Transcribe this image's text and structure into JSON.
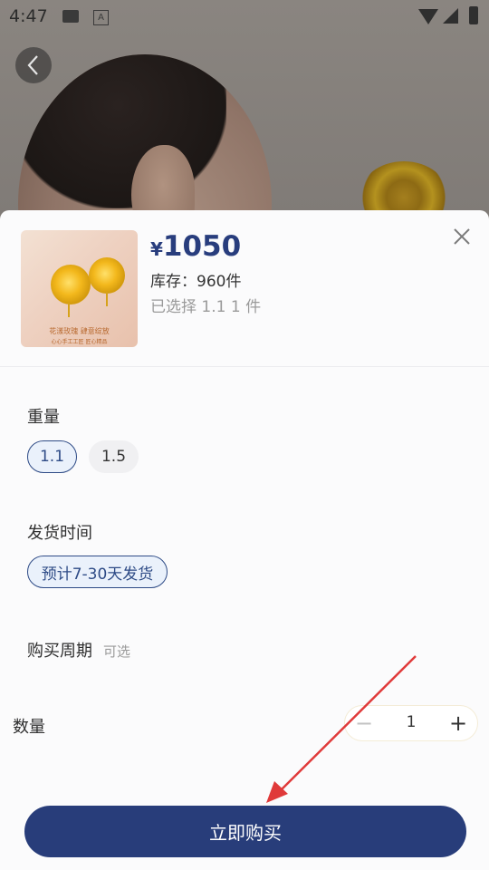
{
  "status_bar": {
    "time": "4:47",
    "icons": [
      "image-icon",
      "text-a-icon",
      "wifi-icon",
      "cell-signal-icon",
      "battery-charging-icon"
    ]
  },
  "product": {
    "thumb_caption": "花漾玫瑰 肆意绽放",
    "thumb_caption_small": "心心手工工匠 匠心精品",
    "currency": "¥",
    "price": "1050",
    "stock_text": "库存：960件",
    "selected_text": "已选择 1.1 1 件"
  },
  "weight": {
    "label": "重量",
    "options": [
      "1.1",
      "1.5"
    ],
    "selected": "1.1"
  },
  "shipping": {
    "label": "发货时间",
    "options": [
      "预计7-30天发货"
    ],
    "selected": "预计7-30天发货"
  },
  "cycle": {
    "label": "购买周期",
    "hint": "可选"
  },
  "quantity": {
    "label": "数量",
    "value": "1",
    "minus": "−",
    "plus": "+"
  },
  "buy_button": {
    "label": "立即购买"
  },
  "colors": {
    "accent": "#283d7a",
    "price": "#283d7d",
    "annotation_arrow": "#e03a3a"
  }
}
